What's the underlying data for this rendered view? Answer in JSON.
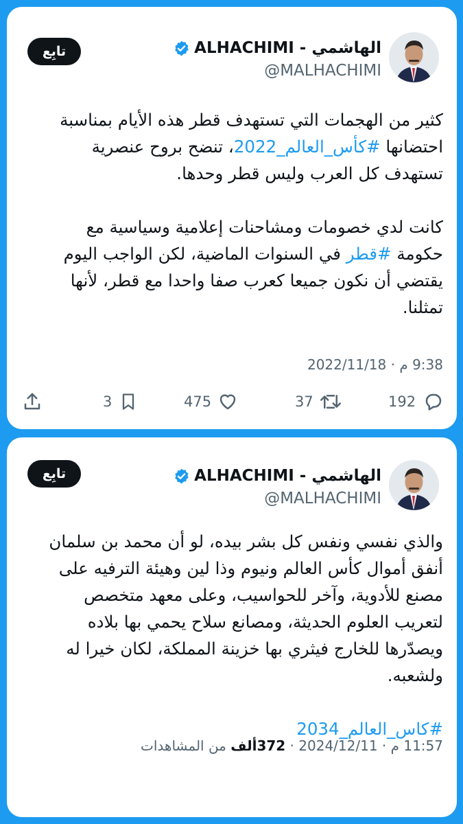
{
  "tweets": [
    {
      "author_name": "ALHACHIMI - الهاشمي",
      "handle": "@MALHACHIMI",
      "follow_label": "تابِع",
      "lines": [
        {
          "pre": "كثير من الهجمات التي تستهدف قطر هذه الأيام بمناسبة",
          "link": "",
          "post": ""
        },
        {
          "pre": "احتضانها ",
          "link": "#كأس_العالم_2022",
          "post": "، تنضح بروح عنصرية"
        },
        {
          "pre": "تستهدف كل العرب وليس قطر وحدها.",
          "link": "",
          "post": ""
        }
      ],
      "lines2": [
        {
          "pre": "كانت لدي خصومات ومشاحنات إعلامية وسياسية مع",
          "link": "",
          "post": ""
        },
        {
          "pre": "حكومة ",
          "link": "#قطر",
          "post": " في السنوات الماضية، لكن الواجب اليوم"
        },
        {
          "pre": "يقتضي أن نكون جميعا كعرب صفا واحدا مع قطر، لأنها",
          "link": "",
          "post": ""
        },
        {
          "pre": "تمثلنا.",
          "link": "",
          "post": ""
        }
      ],
      "timestamp": "9:38 م · 2022/11/18",
      "replies": "192",
      "retweets": "37",
      "likes": "475",
      "bookmarks": "3"
    },
    {
      "author_name": "ALHACHIMI - الهاشمي",
      "handle": "@MALHACHIMI",
      "follow_label": "تابِع",
      "lines": [
        "والذي نفسي ونفس كل بشر بيده، لو أن محمد بن سلمان",
        "أنفق أموال كأس العالم ونيوم وذا لين وهيئة الترفيه على",
        "مصنع للأدوية، وآخر للحواسيب، وعلى معهد متخصص",
        "لتعريب العلوم الحديثة، ومصانع سلاح يحمي بها بلاده",
        "ويصدّرها للخارج فيثري بها خزينة المملكة، لكان خيرا له",
        "ولشعبه."
      ],
      "hashtag": "#كاس_العالم_2034",
      "timestamp": "11:57 م · 2024/12/11",
      "views_count": "372ألف",
      "views_label": "من المشاهدات"
    }
  ],
  "colors": {
    "background": "#1d9bf0",
    "link": "#1d9bf0",
    "text": "#0f1419",
    "muted": "#536471",
    "verified": "#1d9bf0"
  },
  "icons": [
    "verified-badge-icon",
    "reply-icon",
    "retweet-icon",
    "like-icon",
    "bookmark-icon",
    "share-icon"
  ]
}
